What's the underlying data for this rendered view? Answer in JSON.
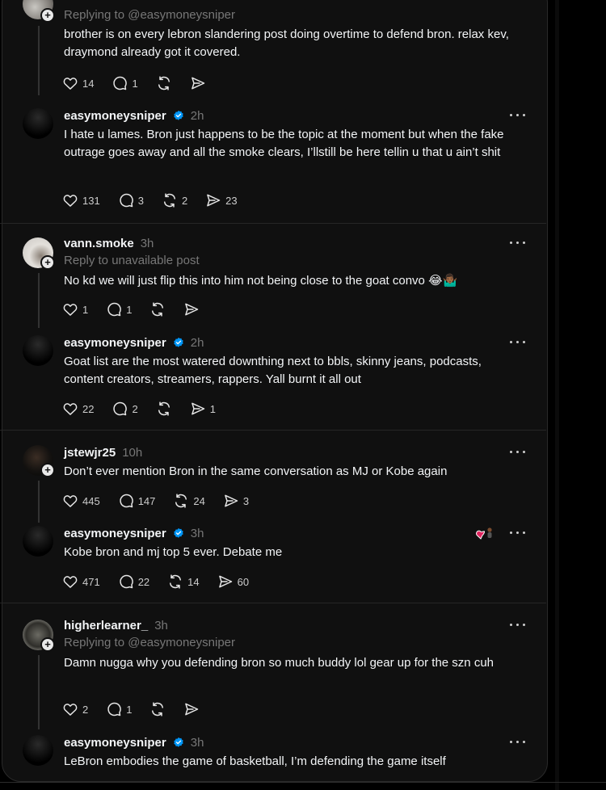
{
  "posts": [
    {
      "id": "p1",
      "username": "",
      "time": "",
      "reply_to": "Replying to @easymoneysniper",
      "text": "brother is on every lebron slandering post doing overtime to defend bron. relax kev, draymond already got it covered.",
      "likes": "14",
      "replies": "1",
      "reposts": "",
      "shares": ""
    },
    {
      "id": "p2",
      "username": "easymoneysniper",
      "verified": true,
      "time": "2h",
      "text": "I hate u lames. Bron just happens to be the topic at the moment but when the fake outrage goes away and all the smoke clears, I’llstill be here tellin u that u ain’t shit",
      "likes": "131",
      "replies": "3",
      "reposts": "2",
      "shares": "23"
    },
    {
      "id": "p3",
      "username": "vann.smoke",
      "time": "3h",
      "reply_to": "Reply to unavailable post",
      "text": "No kd we will just flip this into him not being close to the goat convo 😂🤷🏾‍♂️",
      "likes": "1",
      "replies": "1",
      "reposts": "",
      "shares": ""
    },
    {
      "id": "p4",
      "username": "easymoneysniper",
      "verified": true,
      "time": "2h",
      "text": "Goat list are the most watered downthing next to bbls, skinny jeans, podcasts, content creators, streamers, rappers. Yall burnt it all out",
      "likes": "22",
      "replies": "2",
      "reposts": "",
      "shares": "1"
    },
    {
      "id": "p5",
      "username": "jstewjr25",
      "time": "10h",
      "text": "Don’t ever mention Bron in the same conversation as MJ or Kobe again",
      "likes": "445",
      "replies": "147",
      "reposts": "24",
      "shares": "3"
    },
    {
      "id": "p6",
      "username": "easymoneysniper",
      "verified": true,
      "time": "3h",
      "text": "Kobe bron and mj top 5 ever. Debate me",
      "likes": "471",
      "replies": "22",
      "reposts": "14",
      "shares": "60"
    },
    {
      "id": "p7",
      "username": "higherlearner_",
      "time": "3h",
      "reply_to": "Replying to @easymoneysniper",
      "text": "Damn nugga why you defending bron so much buddy lol gear up for the szn cuh",
      "likes": "2",
      "replies": "1",
      "reposts": "",
      "shares": ""
    },
    {
      "id": "p8",
      "username": "easymoneysniper",
      "verified": true,
      "time": "3h",
      "text": "LeBron embodies the game of basketball, I’m defending the game itself"
    }
  ],
  "icons": {
    "like": "heart-icon",
    "reply": "speech-bubble-icon",
    "repost": "repost-icon",
    "share": "send-icon",
    "more": "more-dots-icon",
    "verified": "verified-badge-icon",
    "follow": "plus-icon"
  },
  "colors": {
    "background": "#101010",
    "text": "#f3f5f7",
    "secondary_text": "#777777",
    "verified": "#0095f6",
    "thread_line": "#333333"
  }
}
